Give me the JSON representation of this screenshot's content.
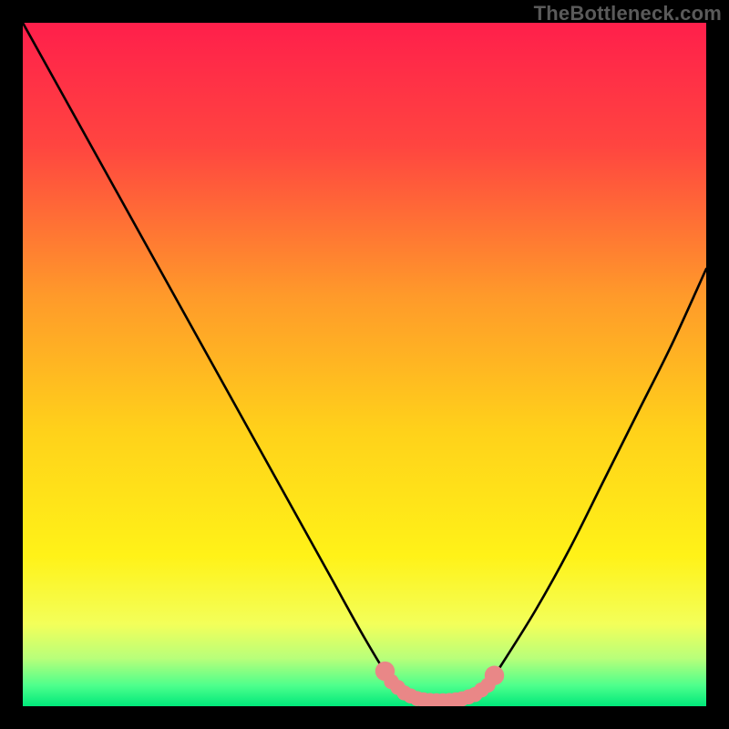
{
  "watermark": "TheBottleneck.com",
  "gradient_stops": [
    {
      "offset": 0,
      "color": "#ff1f4b"
    },
    {
      "offset": 0.18,
      "color": "#ff4540"
    },
    {
      "offset": 0.4,
      "color": "#ff9a2a"
    },
    {
      "offset": 0.6,
      "color": "#ffd21a"
    },
    {
      "offset": 0.78,
      "color": "#fff218"
    },
    {
      "offset": 0.88,
      "color": "#f3ff5a"
    },
    {
      "offset": 0.93,
      "color": "#b8ff7a"
    },
    {
      "offset": 0.97,
      "color": "#4dff8c"
    },
    {
      "offset": 1.0,
      "color": "#00e87a"
    }
  ],
  "chart_data": {
    "type": "line",
    "title": "",
    "xlabel": "",
    "ylabel": "",
    "xlim": [
      0,
      100
    ],
    "ylim": [
      0,
      100
    ],
    "series": [
      {
        "name": "bottleneck-curve",
        "x": [
          0,
          5,
          10,
          15,
          20,
          25,
          30,
          35,
          40,
          45,
          50,
          54,
          56,
          58,
          60,
          62,
          64,
          66,
          68,
          70,
          75,
          80,
          85,
          90,
          95,
          100
        ],
        "values": [
          100,
          91,
          82,
          73,
          64,
          55,
          46,
          37,
          28,
          19,
          10,
          3.5,
          1.8,
          1.0,
          0.8,
          0.8,
          1.0,
          1.6,
          3.0,
          6,
          14,
          23,
          33,
          43,
          53,
          64
        ]
      }
    ],
    "highlight_interval_x": [
      53,
      69
    ],
    "highlight_color": "#e98787",
    "highlight_dot_radius": 1.1
  }
}
